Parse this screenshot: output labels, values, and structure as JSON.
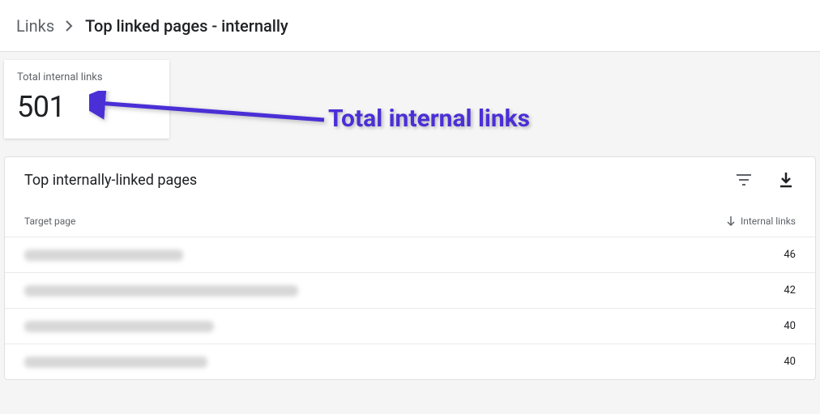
{
  "breadcrumb": {
    "root": "Links",
    "current": "Top linked pages - internally"
  },
  "stat": {
    "label": "Total internal links",
    "value": "501"
  },
  "panel": {
    "title": "Top internally-linked pages"
  },
  "table": {
    "col_target": "Target page",
    "col_links": "Internal links",
    "rows": [
      {
        "url_width": 196,
        "links": "46"
      },
      {
        "url_width": 338,
        "links": "42"
      },
      {
        "url_width": 234,
        "links": "40"
      },
      {
        "url_width": 226,
        "links": "40"
      }
    ]
  },
  "annotation": {
    "text": "Total internal links"
  }
}
